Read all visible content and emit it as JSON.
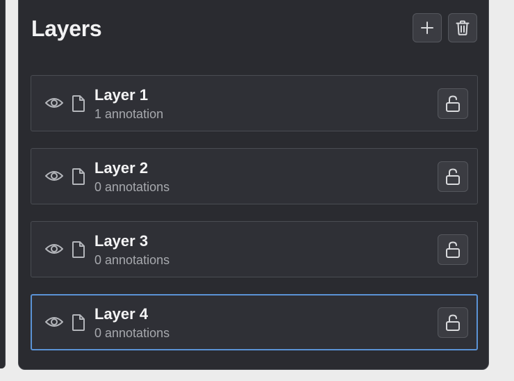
{
  "panel": {
    "title": "Layers",
    "add_button": {
      "icon": "plus-icon"
    },
    "delete_button": {
      "icon": "trash-icon"
    }
  },
  "layers": [
    {
      "name": "Layer 1",
      "subtitle": "1 annotation",
      "visible": true,
      "locked": false,
      "selected": false
    },
    {
      "name": "Layer 2",
      "subtitle": "0 annotations",
      "visible": true,
      "locked": false,
      "selected": false
    },
    {
      "name": "Layer 3",
      "subtitle": "0 annotations",
      "visible": true,
      "locked": false,
      "selected": false
    },
    {
      "name": "Layer 4",
      "subtitle": "0 annotations",
      "visible": true,
      "locked": false,
      "selected": true
    }
  ],
  "colors": {
    "panel_bg": "#2a2b30",
    "row_bg": "#2f3036",
    "selected_border": "#5b93d6",
    "text_primary": "#f4f4f5",
    "text_secondary": "#a7a9ae",
    "icon": "#b4b6bb"
  }
}
